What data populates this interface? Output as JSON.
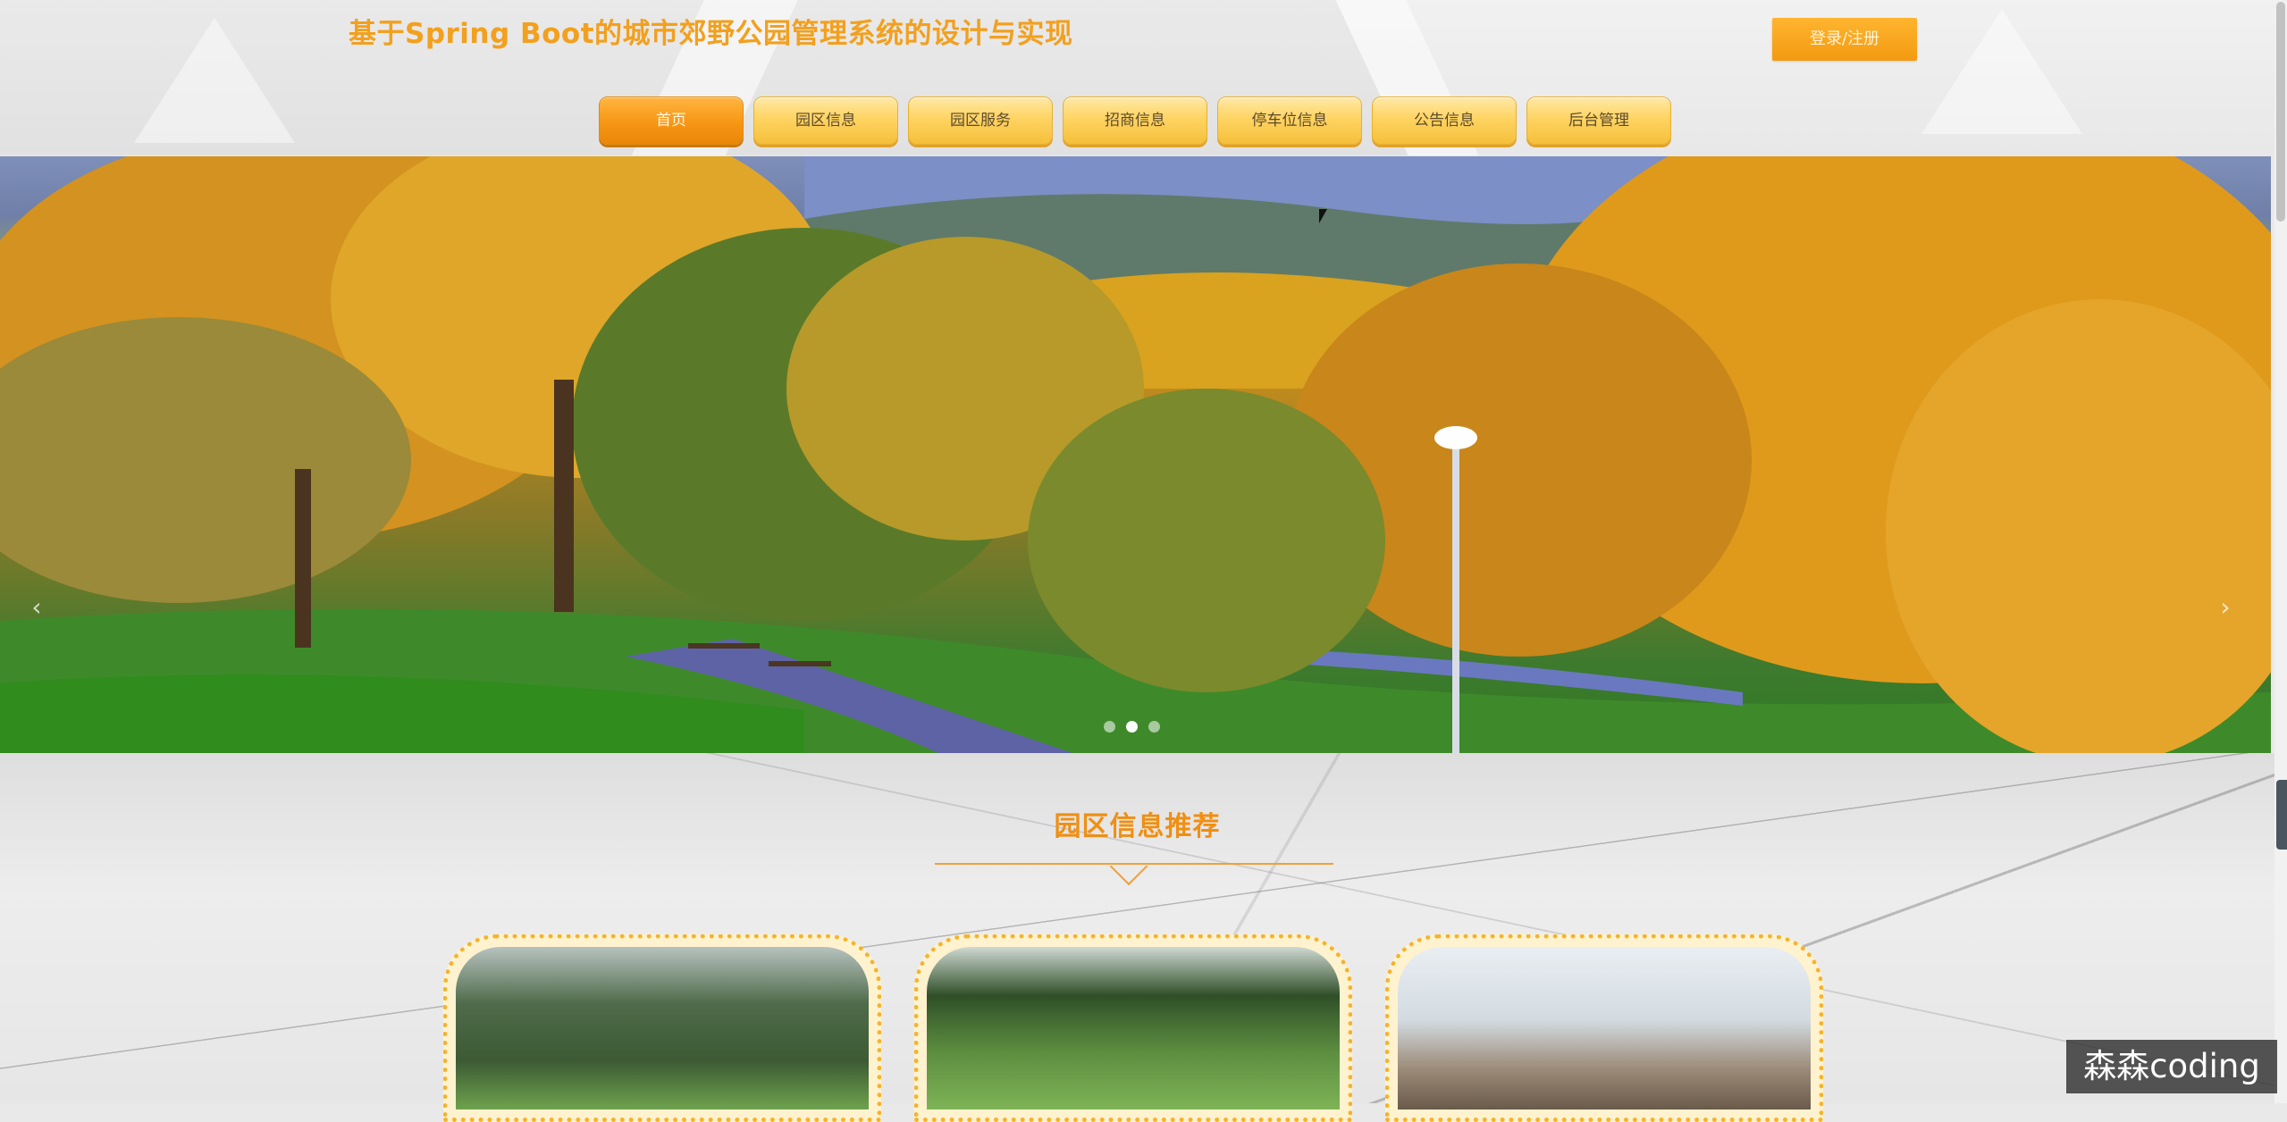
{
  "header": {
    "title": "基于Spring Boot的城市郊野公园管理系统的设计与实现",
    "login_button": "登录/注册"
  },
  "nav": {
    "items": [
      {
        "label": "首页",
        "active": true
      },
      {
        "label": "园区信息",
        "active": false
      },
      {
        "label": "园区服务",
        "active": false
      },
      {
        "label": "招商信息",
        "active": false
      },
      {
        "label": "停车位信息",
        "active": false
      },
      {
        "label": "公告信息",
        "active": false
      },
      {
        "label": "后台管理",
        "active": false
      }
    ]
  },
  "banner": {
    "prev_icon": "‹",
    "next_icon": "›",
    "slides": 3,
    "active_slide": 2
  },
  "section": {
    "title": "园区信息推荐",
    "cards": 3
  },
  "watermark": "森森coding",
  "colors": {
    "accent": "#f2a01e",
    "nav_active": "#f59412",
    "nav_normal": "#ffd463"
  }
}
